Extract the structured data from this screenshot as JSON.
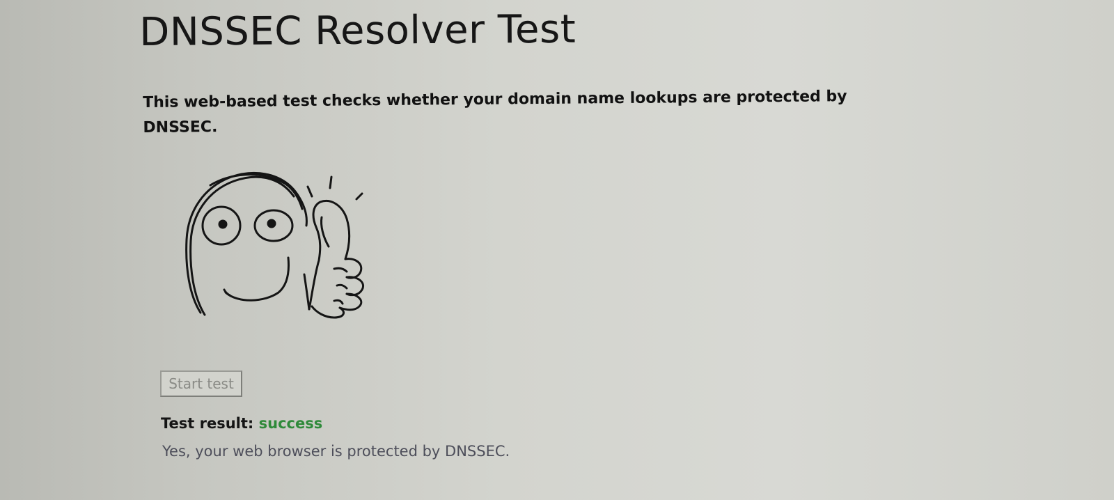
{
  "title": "DNSSEC Resolver Test",
  "intro": "This web-based test checks whether your domain name lookups are protected by DNSSEC.",
  "illustration": {
    "icon": "thumbs-up-face-icon"
  },
  "start_button": {
    "label": "Start test"
  },
  "result": {
    "label": "Test result:",
    "status": "success",
    "status_color": "#2f8a3a",
    "message": "Yes, your web browser is protected by DNSSEC."
  }
}
